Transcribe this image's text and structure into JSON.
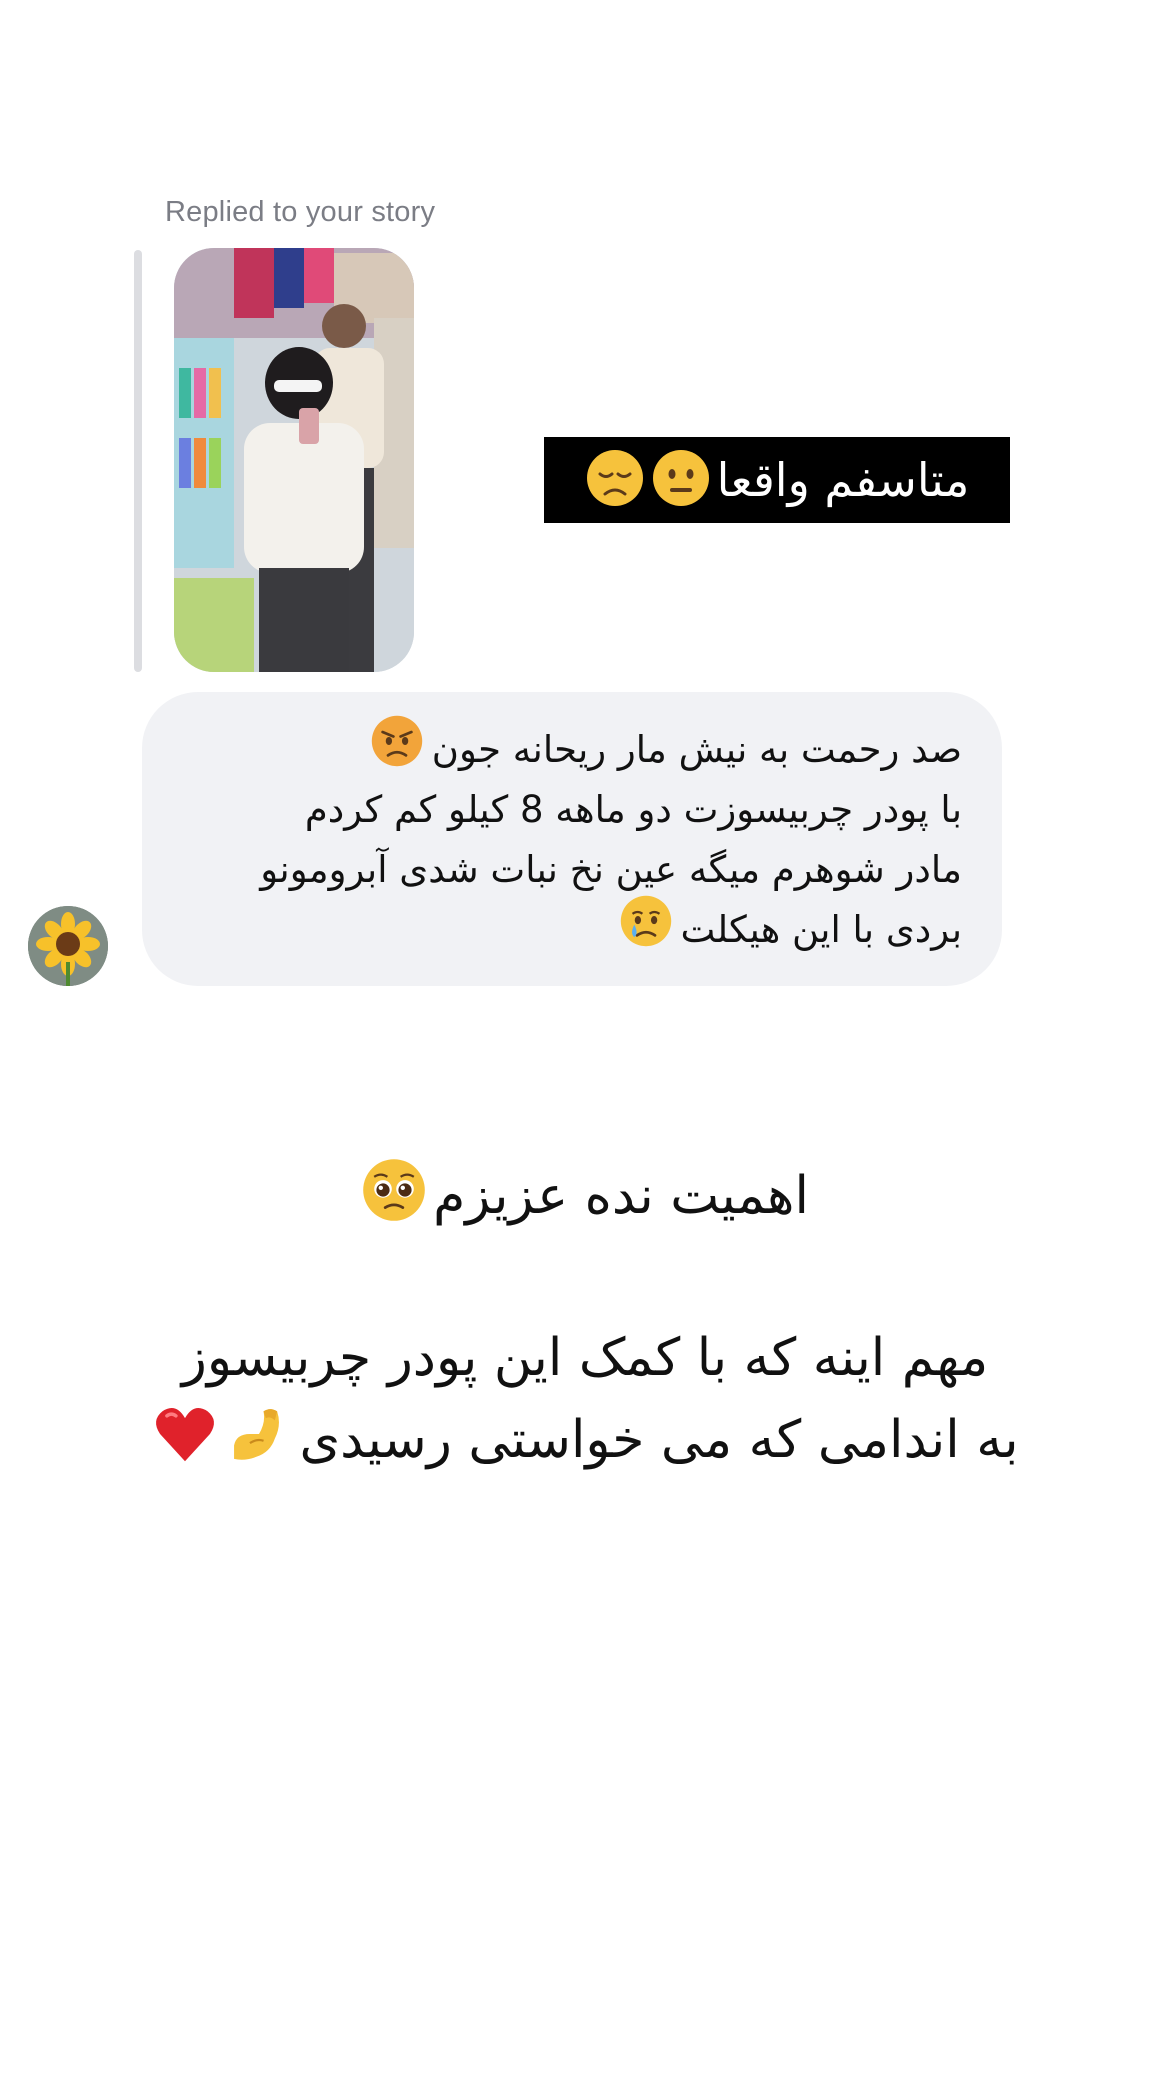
{
  "reply": {
    "label": "Replied to your story"
  },
  "story": {
    "caption": "متاسفم واقعا",
    "caption_emojis": [
      "neutral-face-emoji",
      "disappointed-face-emoji"
    ]
  },
  "message": {
    "lines": [
      "صد رحمت به نیش مار ریحانه جون",
      "با پودر چربیسوزت دو ماهه 8 کیلو کم کردم",
      "مادر شوهرم میگه عین نخ نبات شدی آبرومونو",
      "بردی با این هیکلت"
    ],
    "line_emojis": [
      "angry-face-emoji",
      "crying-face-emoji"
    ],
    "avatar": "sunflower-avatar"
  },
  "story_overlay": {
    "line1": "اهمیت نده عزیزم",
    "line2": "مهم اینه که با کمک این پودر چربیسوز",
    "line3": "به اندامی که می خواستی رسیدی",
    "emojis": [
      "pleading-face-emoji",
      "flexed-biceps-emoji",
      "red-heart-emoji"
    ]
  },
  "colors": {
    "bubble_background": "#f1f2f5",
    "reply_label": "#7b7d85",
    "caption_background": "#000000"
  }
}
